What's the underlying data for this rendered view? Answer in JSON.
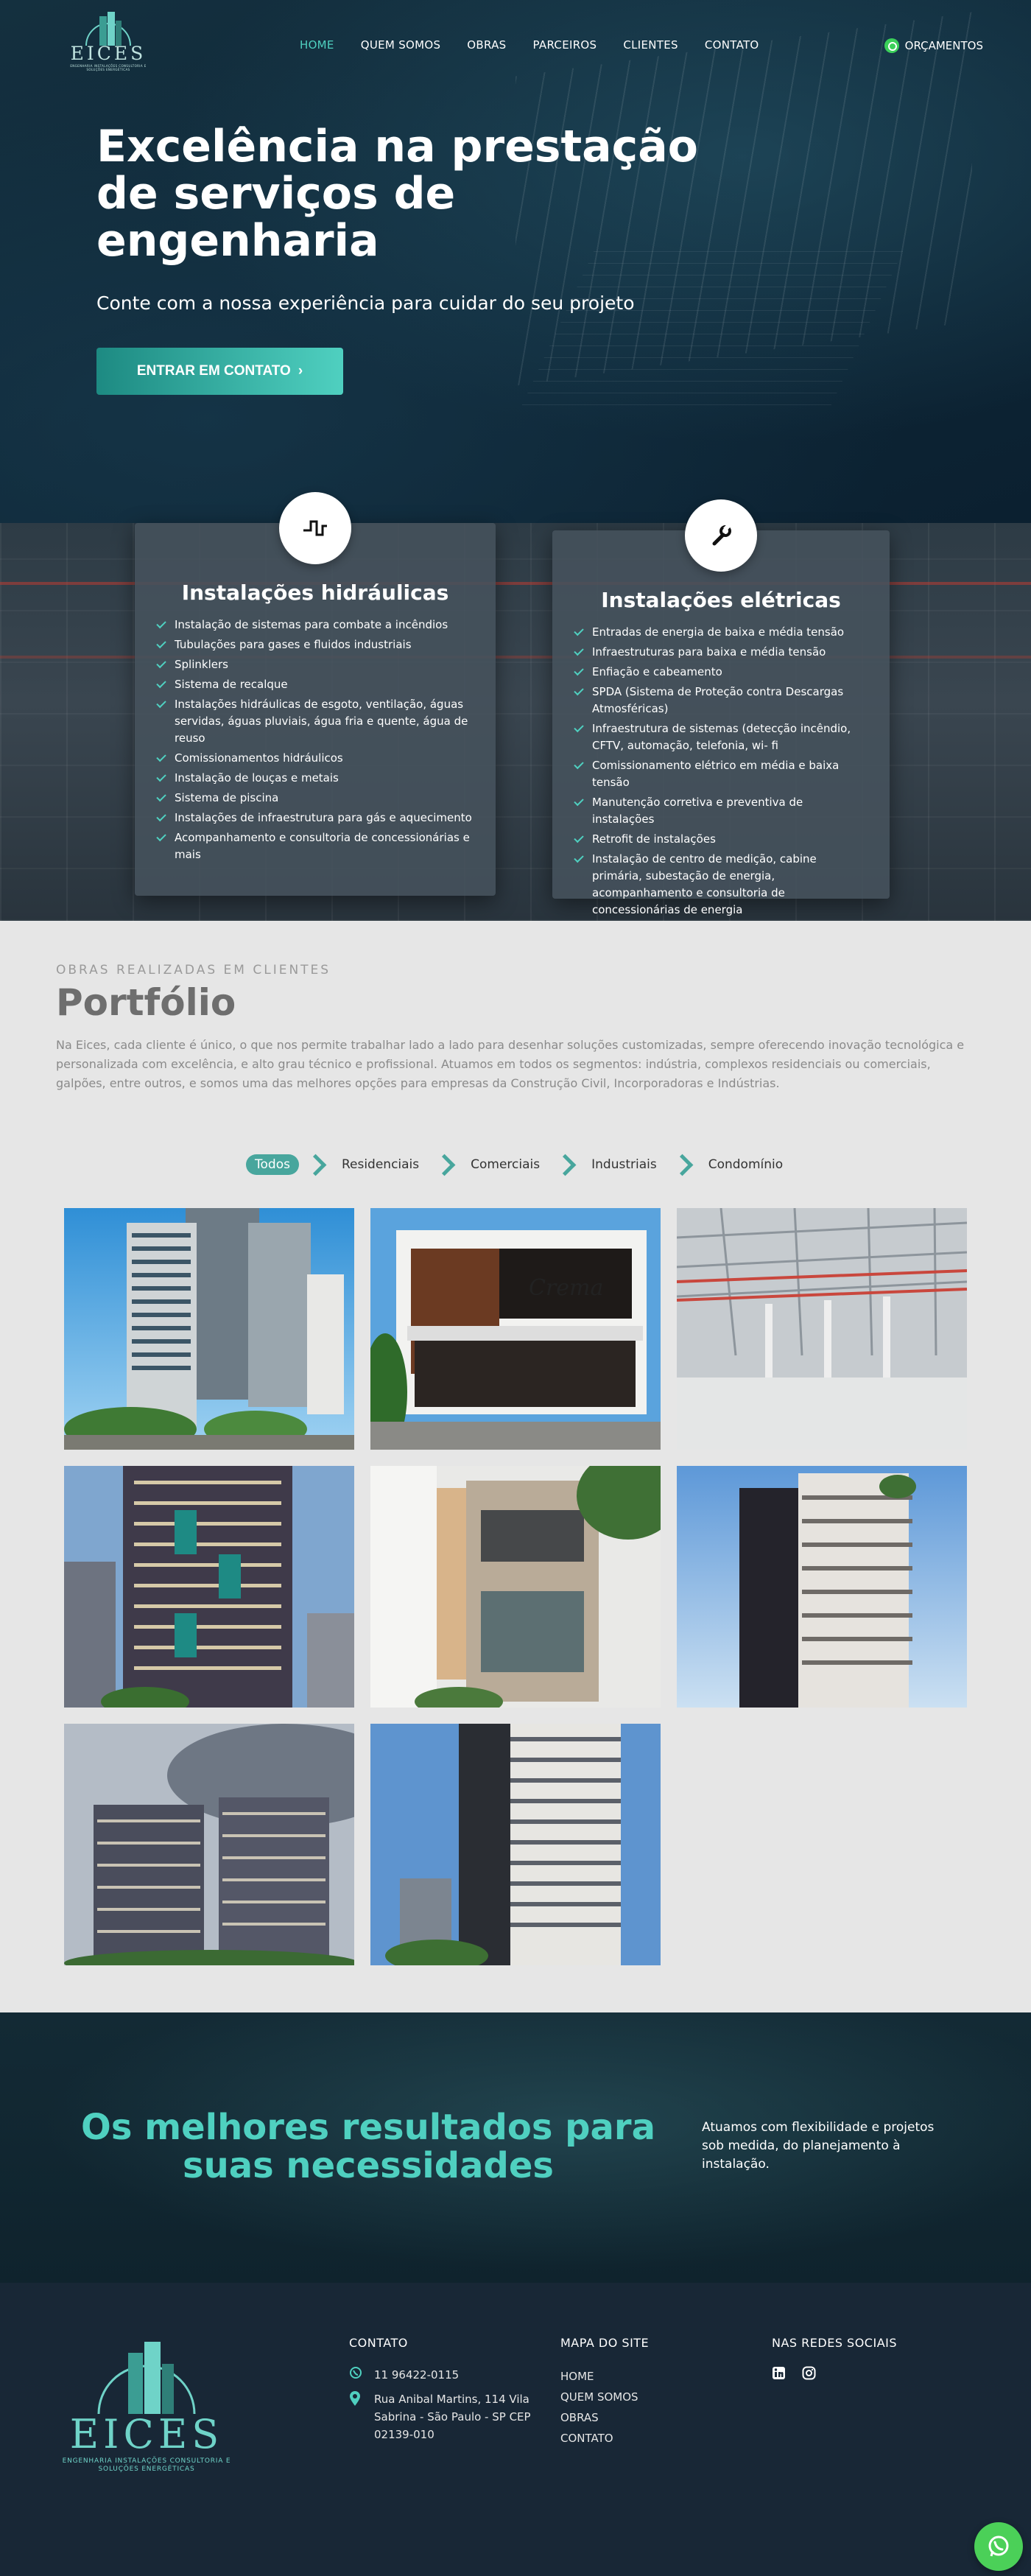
{
  "brand": {
    "name": "EICES",
    "tagline": "ENGENHARIA INSTALAÇÕES CONSULTORIA E SOLUÇÕES ENERGÉTICAS",
    "accent": "#4fd0c0",
    "dark": "#182736"
  },
  "nav": {
    "items": [
      "HOME",
      "QUEM SOMOS",
      "OBRAS",
      "PARCEIROS",
      "CLIENTES",
      "CONTATO"
    ],
    "active": "HOME",
    "quote_label": "ORÇAMENTOS",
    "quote_icon": "whatsapp-icon"
  },
  "hero": {
    "title": "Excelência na prestação de serviços de engenharia",
    "subtitle": "Conte com a nossa experiência para cuidar do seu projeto",
    "cta_label": "ENTRAR EM CONTATO"
  },
  "services": [
    {
      "title": "Instalações hidráulicas",
      "icon": "water-pipe-icon",
      "items": [
        "Instalação de sistemas para combate a incêndios",
        "Tubulações para gases e fluidos industriais",
        "Splinklers",
        "Sistema de recalque",
        "Instalações hidráulicas de esgoto, ventilação, águas servidas, águas pluviais, água fria e quente, água de reuso",
        "Comissionamentos hidráulicos",
        "Instalação de louças e metais",
        "Sistema de piscina",
        "Instalações de infraestrutura para gás e aquecimento",
        "Acompanhamento e consultoria de concessionárias e mais"
      ]
    },
    {
      "title": "Instalações elétricas",
      "icon": "wrench-icon",
      "items": [
        "Entradas de energia de baixa e média tensão",
        "Infraestruturas para baixa e média tensão",
        "Enfiação e cabeamento",
        "SPDA (Sistema de Proteção contra Descargas Atmosféricas)",
        "Infraestrutura de sistemas (detecção incêndio, CFTV, automação, telefonia, wi- fi",
        "Comissionamento elétrico em média e baixa tensão",
        "Manutenção corretiva e preventiva de instalações",
        "Retrofit de instalações",
        "Instalação de centro de medição, cabine primária, subestação de energia, acompanhamento e consultoria de concessionárias de energia"
      ]
    }
  ],
  "portfolio": {
    "eyebrow": "OBRAS REALIZADAS EM CLIENTES",
    "title": "Portfólio",
    "description": "Na Eices, cada cliente é único, o que nos permite trabalhar lado a lado para desenhar soluções customizadas, sempre oferecendo inovação tecnológica e personalizada com excelência, e alto grau técnico e profissional. Atuamos em todos os segmentos: indústria, complexos residenciais ou comerciais, galpões, entre outros, e somos uma das melhores opções para empresas da Construção Civil, Incorporadoras e Indústrias.",
    "filters": [
      "Todos",
      "Residenciais",
      "Comerciais",
      "Industriais",
      "Condomínio"
    ],
    "active_filter": "Todos",
    "sign_text": "Crema",
    "projects": [
      {
        "kind": "residential-tower"
      },
      {
        "kind": "commercial-storefront"
      },
      {
        "kind": "industrial-warehouse"
      },
      {
        "kind": "residential-tower-dark"
      },
      {
        "kind": "residential-facade"
      },
      {
        "kind": "residential-tower-balconies"
      },
      {
        "kind": "condominium-towers"
      },
      {
        "kind": "residential-tower-tall"
      }
    ]
  },
  "results": {
    "title": "Os melhores resultados para suas necessidades",
    "text": "Atuamos com flexibilidade e projetos sob medida, do planejamento à instalação."
  },
  "footer": {
    "contact_title": "CONTATO",
    "phone": "11 96422-0115",
    "address": "Rua Anibal Martins, 114 Vila Sabrina - São Paulo - SP CEP 02139-010",
    "sitemap_title": "MAPA DO SITE",
    "sitemap": [
      "HOME",
      "QUEM SOMOS",
      "OBRAS",
      "CONTATO"
    ],
    "social_title": "NAS REDES SOCIAIS",
    "social": [
      "linkedin-icon",
      "instagram-icon"
    ]
  }
}
